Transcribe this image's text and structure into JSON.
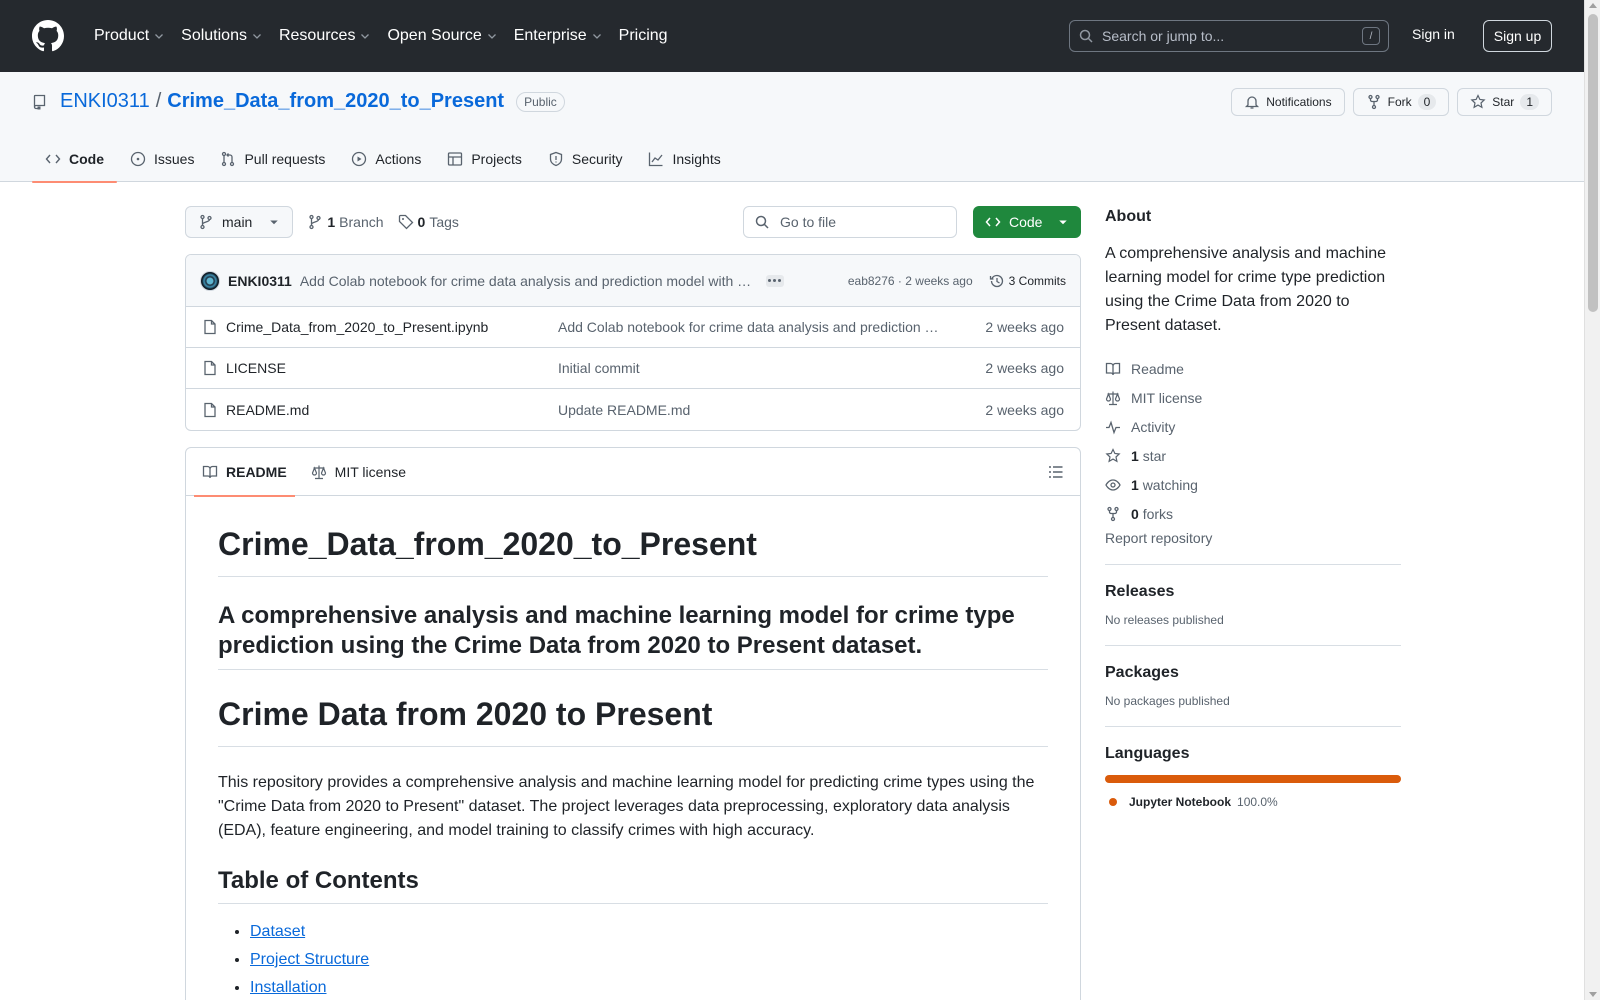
{
  "header": {
    "nav": [
      "Product",
      "Solutions",
      "Resources",
      "Open Source",
      "Enterprise",
      "Pricing"
    ],
    "search_placeholder": "Search or jump to...",
    "search_shortcut": "/",
    "sign_in": "Sign in",
    "sign_up": "Sign up"
  },
  "repo": {
    "owner": "ENKI0311",
    "separator": "/",
    "name": "Crime_Data_from_2020_to_Present",
    "visibility": "Public",
    "notifications_label": "Notifications",
    "fork_label": "Fork",
    "fork_count": "0",
    "star_label": "Star",
    "star_count": "1",
    "tabs": [
      "Code",
      "Issues",
      "Pull requests",
      "Actions",
      "Projects",
      "Security",
      "Insights"
    ]
  },
  "toolbar": {
    "branch": "main",
    "branch_count": "1",
    "branch_label": "Branch",
    "tag_count": "0",
    "tag_label": "Tags",
    "goto_placeholder": "Go to file",
    "code_label": "Code"
  },
  "commit": {
    "author": "ENKI0311",
    "message": "Add Colab notebook for crime data analysis and prediction model with …",
    "hash": "eab8276",
    "meta_sep": "·",
    "time": "2 weeks ago",
    "commits_label": "3 Commits"
  },
  "files": [
    {
      "name": "Crime_Data_from_2020_to_Present.ipynb",
      "commit": "Add Colab notebook for crime data analysis and prediction …",
      "date": "2 weeks ago"
    },
    {
      "name": "LICENSE",
      "commit": "Initial commit",
      "date": "2 weeks ago"
    },
    {
      "name": "README.md",
      "commit": "Update README.md",
      "date": "2 weeks ago"
    }
  ],
  "readme": {
    "tab_readme": "README",
    "tab_license": "MIT license",
    "h1": "Crime_Data_from_2020_to_Present",
    "h3": "A comprehensive analysis and machine learning model for crime type prediction using the Crime Data from 2020 to Present dataset.",
    "h1b": "Crime Data from 2020 to Present",
    "paragraph": "This repository provides a comprehensive analysis and machine learning model for predicting crime types using the \"Crime Data from 2020 to Present\" dataset. The project leverages data preprocessing, exploratory data analysis (EDA), feature engineering, and model training to classify crimes with high accuracy.",
    "toc_title": "Table of Contents",
    "toc": [
      "Dataset",
      "Project Structure",
      "Installation"
    ]
  },
  "sidebar": {
    "about_title": "About",
    "about_text": "A comprehensive analysis and machine learning model for crime type prediction using the Crime Data from 2020 to Present dataset.",
    "readme": "Readme",
    "license": "MIT license",
    "activity": "Activity",
    "stars_count": "1",
    "stars_label": "star",
    "watching_count": "1",
    "watching_label": "watching",
    "forks_count": "0",
    "forks_label": "forks",
    "report": "Report repository",
    "releases_title": "Releases",
    "releases_text": "No releases published",
    "packages_title": "Packages",
    "packages_text": "No packages published",
    "languages_title": "Languages",
    "language_name": "Jupyter Notebook",
    "language_pct": "100.0%",
    "language_share": 1.0,
    "language_color": "#da5b0b"
  },
  "colors": {
    "header_bg": "#25292e",
    "link": "#0969da",
    "code_button": "#1f883d",
    "active_tab": "#fd8c73"
  }
}
